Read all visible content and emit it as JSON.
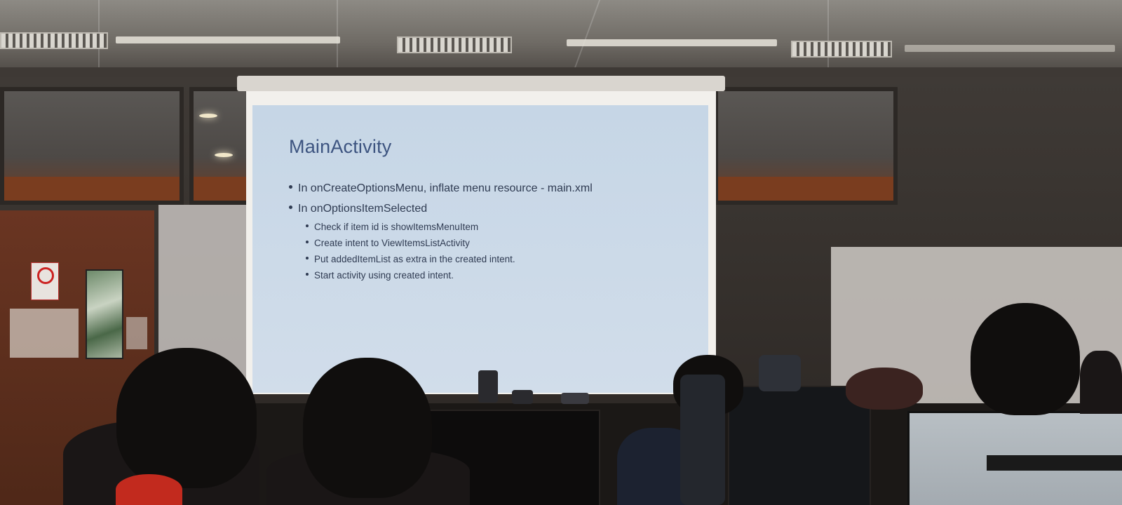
{
  "slide": {
    "title": "MainActivity",
    "bullets": [
      {
        "text": "In onCreateOptionsMenu, inflate menu resource - main.xml",
        "subbullets": []
      },
      {
        "text": "In onOptionsItemSelected",
        "subbullets": [
          "Check if item id is showItemsMenuItem",
          "Create intent to ViewItemsListActivity",
          "Put addedItemList as extra in the created intent.",
          "Start activity using created intent."
        ]
      }
    ]
  },
  "colors": {
    "slide_background": "#c9d8e8",
    "slide_title": "#3d5480",
    "slide_text": "#2f3b52"
  }
}
